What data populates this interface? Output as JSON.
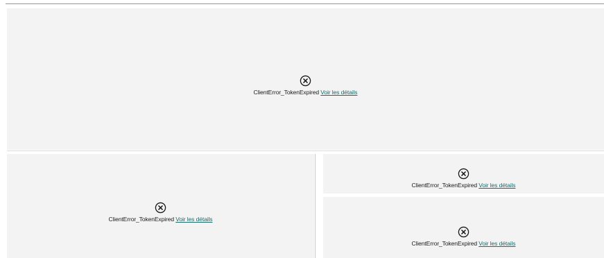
{
  "tiles": [
    {
      "error_code": "ClientError_TokenExpired",
      "details_link": "Voir les détails",
      "icon": "close-circle-icon"
    },
    {
      "error_code": "ClientError_TokenExpired",
      "details_link": "Voir les détails",
      "icon": "close-circle-icon"
    },
    {
      "error_code": "ClientError_TokenExpired",
      "details_link": "Voir les détails",
      "icon": "close-circle-icon"
    },
    {
      "error_code": "ClientError_TokenExpired",
      "details_link": "Voir les détails",
      "icon": "close-circle-icon"
    }
  ],
  "colors": {
    "tile_background": "#f3f3f3",
    "link": "#1d6b6b",
    "top_rule": "#8f8bd6",
    "text": "#1a1a1a"
  }
}
